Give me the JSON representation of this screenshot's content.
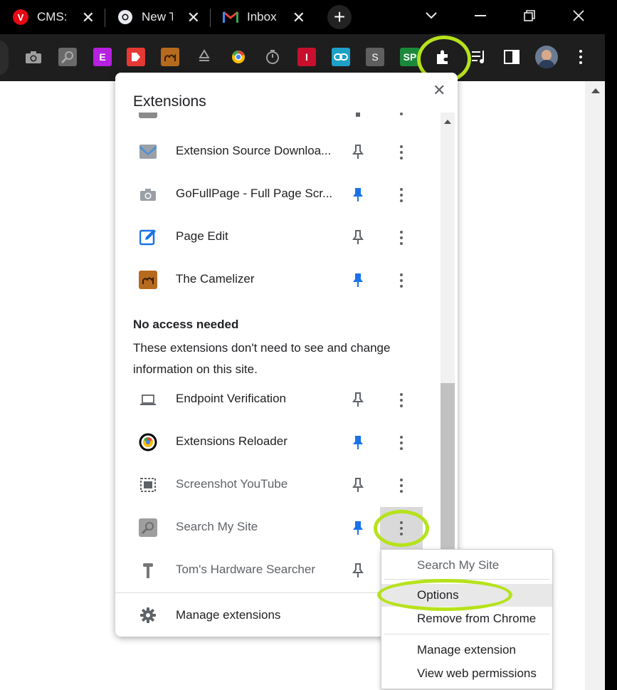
{
  "tabs": [
    {
      "title": "CMS:",
      "favicon": "red-v-icon",
      "favicon_text": "V",
      "color": "#e50914"
    },
    {
      "title": "New T",
      "favicon": "chrome-icon"
    },
    {
      "title": "Inbox",
      "favicon": "gmail-icon"
    }
  ],
  "popup": {
    "title": "Extensions",
    "items": [
      {
        "name": "Extension Source Downloa...",
        "icon": "envelope-icon",
        "pinned": false
      },
      {
        "name": "GoFullPage - Full Page Scr...",
        "icon": "camera-icon",
        "pinned": true
      },
      {
        "name": "Page Edit",
        "icon": "edit-icon",
        "pinned": false
      },
      {
        "name": "The Camelizer",
        "icon": "camel-icon",
        "pinned": true
      }
    ],
    "section": {
      "heading": "No access needed",
      "description": "These extensions don't need to see and change information on this site."
    },
    "no_access_items": [
      {
        "name": "Endpoint Verification",
        "icon": "laptop-icon",
        "pinned": false
      },
      {
        "name": "Extensions Reloader",
        "icon": "reload-icon",
        "pinned": true
      },
      {
        "name": "Screenshot YouTube",
        "icon": "screenshot-icon",
        "pinned": false
      },
      {
        "name": "Search My Site",
        "icon": "search-site-icon",
        "pinned": true
      },
      {
        "name": "Tom's Hardware Searcher",
        "icon": "hammer-icon",
        "pinned": false
      }
    ],
    "footer": {
      "label": "Manage extensions"
    }
  },
  "context_menu": {
    "title": "Search My Site",
    "options": "Options",
    "remove": "Remove from Chrome",
    "manage": "Manage extension",
    "permissions": "View web permissions"
  },
  "colors": {
    "highlight_ring": "#b6e21c",
    "pin_active": "#1a73e8",
    "pin_inactive": "#5f6368"
  }
}
